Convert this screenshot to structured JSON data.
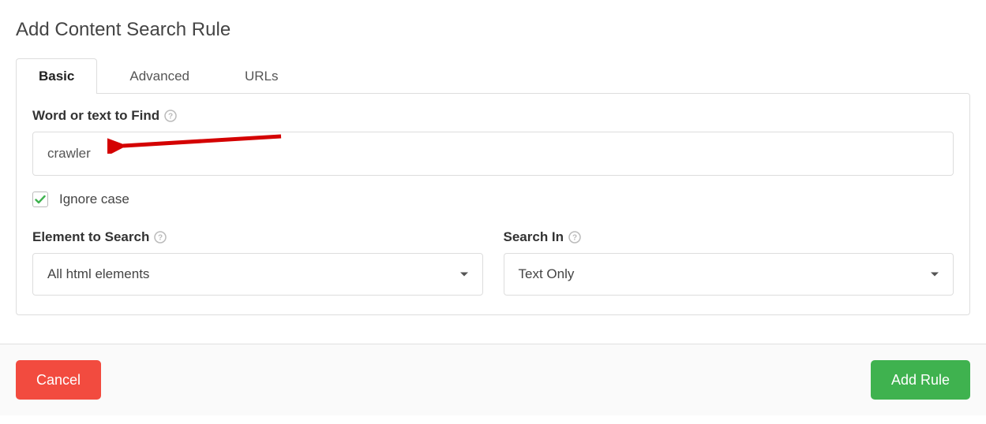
{
  "title": "Add Content Search Rule",
  "tabs": {
    "basic": "Basic",
    "advanced": "Advanced",
    "urls": "URLs",
    "active": "basic"
  },
  "fields": {
    "word_to_find": {
      "label": "Word or text to Find",
      "value": "crawler",
      "placeholder": ""
    },
    "ignore_case": {
      "label": "Ignore case",
      "checked": true
    },
    "element_to_search": {
      "label": "Element to Search",
      "value": "All html elements"
    },
    "search_in": {
      "label": "Search In",
      "value": "Text Only"
    }
  },
  "buttons": {
    "cancel": "Cancel",
    "add_rule": "Add Rule"
  },
  "annotation": {
    "arrow_color": "#d40101"
  }
}
